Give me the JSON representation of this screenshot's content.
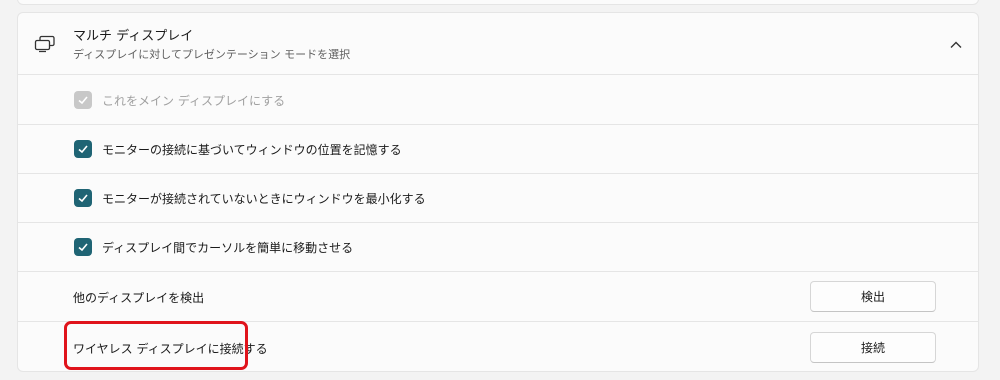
{
  "section": {
    "title": "マルチ ディスプレイ",
    "subtitle": "ディスプレイに対してプレゼンテーション モードを選択",
    "icon": "multi-display-icon",
    "expand_icon": "chevron-up-icon"
  },
  "checkboxes": [
    {
      "label": "これをメイン ディスプレイにする",
      "checked": true,
      "disabled": true
    },
    {
      "label": "モニターの接続に基づいてウィンドウの位置を記憶する",
      "checked": true,
      "disabled": false
    },
    {
      "label": "モニターが接続されていないときにウィンドウを最小化する",
      "checked": true,
      "disabled": false
    },
    {
      "label": "ディスプレイ間でカーソルを簡単に移動させる",
      "checked": true,
      "disabled": false
    }
  ],
  "detect": {
    "label": "他のディスプレイを検出",
    "button": "検出"
  },
  "wireless": {
    "label": "ワイヤレス ディスプレイに接続する",
    "button": "接続"
  },
  "colors": {
    "accent": "#1f6474",
    "highlight": "#e0131b",
    "disabled": "#c8c8c8"
  }
}
